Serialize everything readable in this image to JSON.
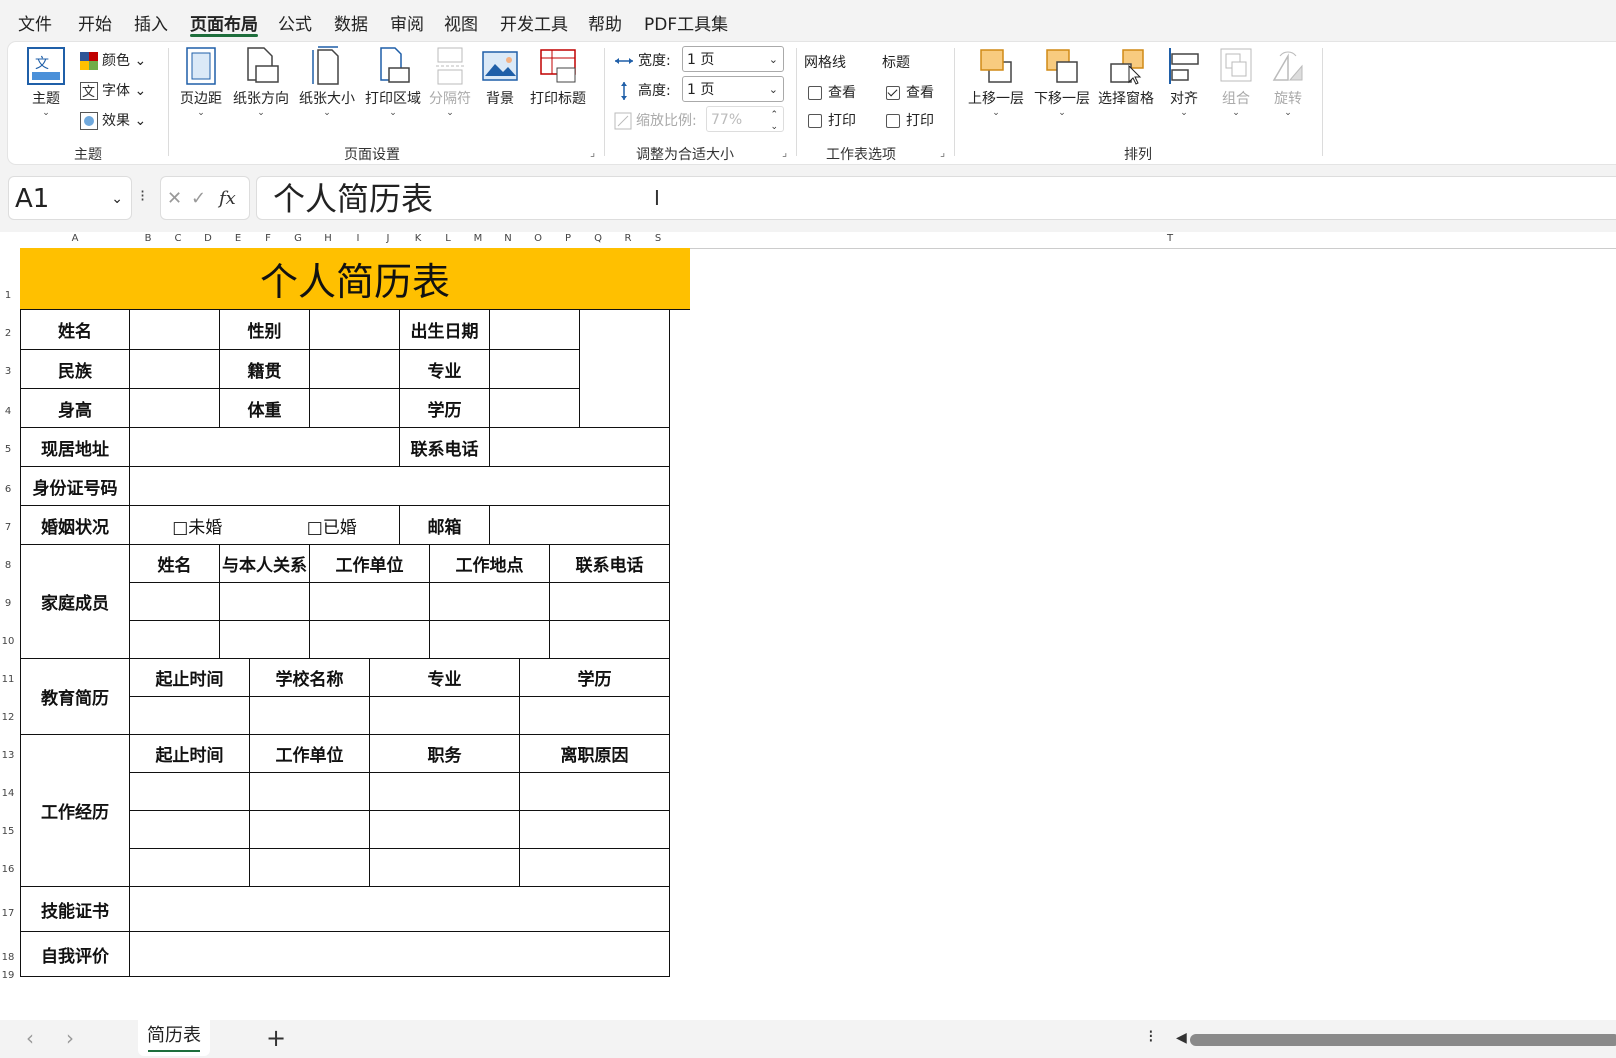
{
  "menu": [
    "文件",
    "开始",
    "插入",
    "页面布局",
    "公式",
    "数据",
    "审阅",
    "视图",
    "开发工具",
    "帮助",
    "PDF工具集"
  ],
  "menu_active": "页面布局",
  "ribbon": {
    "theme": {
      "main": "主题",
      "colors": "颜色",
      "fonts": "字体",
      "effects": "效果",
      "group": "主题"
    },
    "page_setup": {
      "margins": "页边距",
      "orientation": "纸张方向",
      "size": "纸张大小",
      "print_area": "打印区域",
      "breaks": "分隔符",
      "background": "背景",
      "print_titles": "打印标题",
      "group": "页面设置"
    },
    "scale": {
      "width_label": "宽度:",
      "width_value": "1 页",
      "height_label": "高度:",
      "height_value": "1 页",
      "scale_label": "缩放比例:",
      "scale_value": "77%",
      "group": "调整为合适大小"
    },
    "sheet_options": {
      "gridlines": "网格线",
      "headings": "标题",
      "view": "查看",
      "print": "打印",
      "group": "工作表选项"
    },
    "arrange": {
      "bring_forward": "上移一层",
      "send_backward": "下移一层",
      "selection_pane": "选择窗格",
      "align": "对齐",
      "group_btn": "组合",
      "rotate": "旋转",
      "group": "排列"
    }
  },
  "formula_bar": {
    "cell_ref": "A1",
    "content": "个人简历表"
  },
  "columns": [
    "A",
    "B",
    "C",
    "D",
    "E",
    "F",
    "G",
    "H",
    "I",
    "J",
    "K",
    "L",
    "M",
    "N",
    "O",
    "P",
    "Q",
    "R",
    "S",
    "T"
  ],
  "rows": [
    "1",
    "2",
    "3",
    "4",
    "5",
    "6",
    "7",
    "8",
    "9",
    "10",
    "11",
    "12",
    "13",
    "14",
    "15",
    "16",
    "17",
    "18",
    "19"
  ],
  "resume": {
    "title": "个人简历表",
    "name": "姓名",
    "gender": "性别",
    "birth": "出生日期",
    "ethnicity": "民族",
    "native": "籍贯",
    "major": "专业",
    "height": "身高",
    "weight": "体重",
    "education": "学历",
    "address": "现居地址",
    "phone": "联系电话",
    "id_number": "身份证号码",
    "marital": "婚姻状况",
    "unmarried": "□未婚",
    "married": "□已婚",
    "email": "邮箱",
    "family": "家庭成员",
    "fam_name": "姓名",
    "fam_relation": "与本人关系",
    "fam_work": "工作单位",
    "fam_location": "工作地点",
    "fam_phone": "联系电话",
    "edu_history": "教育简历",
    "edu_period": "起止时间",
    "edu_school": "学校名称",
    "edu_major": "专业",
    "edu_degree": "学历",
    "work_history": "工作经历",
    "work_period": "起止时间",
    "work_unit": "工作单位",
    "work_position": "职务",
    "work_reason": "离职原因",
    "certificates": "技能证书",
    "self_eval": "自我评价"
  },
  "sheet_tab": "简历表"
}
